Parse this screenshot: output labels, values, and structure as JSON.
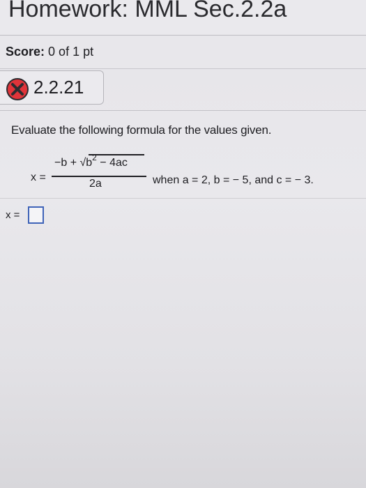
{
  "header": {
    "title": "Homework: MML Sec.2.2a"
  },
  "score": {
    "label": "Score:",
    "value": "0 of 1 pt"
  },
  "question": {
    "status_icon": "incorrect-x-icon",
    "number": "2.2.21",
    "instruction": "Evaluate the following formula for the values given.",
    "formula": {
      "lhs": "x =",
      "numerator": "−b + √",
      "radicand_base": "b",
      "radicand_exp": "2",
      "radicand_rest": " − 4ac",
      "denominator": "2a"
    },
    "conditions": "when a = 2, b = − 5, and c = − 3."
  },
  "answer": {
    "label": "x =",
    "value": ""
  },
  "colors": {
    "incorrect": "#e0343a",
    "input_border": "#3f63b8"
  }
}
